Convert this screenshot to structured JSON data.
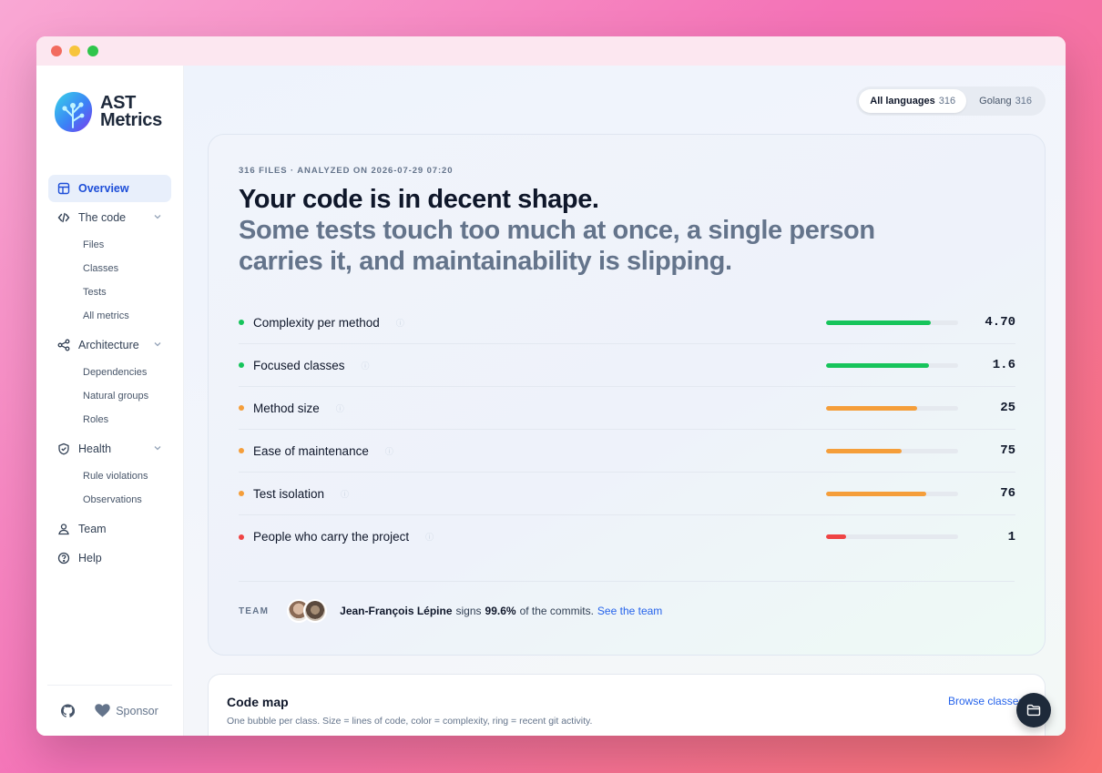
{
  "app": {
    "logo_line1": "AST",
    "logo_line2": "Metrics"
  },
  "sidebar": {
    "items": [
      {
        "label": "Overview",
        "icon": "layout-icon",
        "active": true
      },
      {
        "label": "The code",
        "icon": "code-icon",
        "children": [
          "Files",
          "Classes",
          "Tests",
          "All metrics"
        ]
      },
      {
        "label": "Architecture",
        "icon": "share-icon",
        "children": [
          "Dependencies",
          "Natural groups",
          "Roles"
        ]
      },
      {
        "label": "Health",
        "icon": "shield-icon",
        "children": [
          "Rule violations",
          "Observations"
        ]
      },
      {
        "label": "Team",
        "icon": "user-icon"
      },
      {
        "label": "Help",
        "icon": "help-icon"
      }
    ],
    "sponsor_label": "Sponsor"
  },
  "languages": [
    {
      "label": "All languages",
      "count": "316",
      "active": true
    },
    {
      "label": "Golang",
      "count": "316",
      "active": false
    }
  ],
  "hero": {
    "meta": "316 FILES · ANALYZED ON 2026-07-29 07:20",
    "headline": "Your code is in decent shape.",
    "subheadline": "Some tests touch too much at once, a single person carries it, and maintainability is slipping."
  },
  "metrics": [
    {
      "label": "Complexity per method",
      "value": "4.70",
      "status_color": "#16c45b",
      "fill_pct": 79
    },
    {
      "label": "Focused classes",
      "value": "1.6",
      "status_color": "#16c45b",
      "fill_pct": 78
    },
    {
      "label": "Method size",
      "value": "25",
      "status_color": "#f59e3a",
      "fill_pct": 69
    },
    {
      "label": "Ease of maintenance",
      "value": "75",
      "status_color": "#f59e3a",
      "fill_pct": 57
    },
    {
      "label": "Test isolation",
      "value": "76",
      "status_color": "#f59e3a",
      "fill_pct": 76
    },
    {
      "label": "People who carry the project",
      "value": "1",
      "status_color": "#ef4444",
      "fill_pct": 15
    }
  ],
  "team": {
    "label": "TEAM",
    "person": "Jean-François Lépine",
    "signs": "signs",
    "percent": "99.6%",
    "suffix": "of the commits.",
    "link": "See the team"
  },
  "codemap": {
    "title": "Code map",
    "subtitle": "One bubble per class. Size = lines of code, color = complexity, ring = recent git activity.",
    "link": "Browse classes"
  }
}
